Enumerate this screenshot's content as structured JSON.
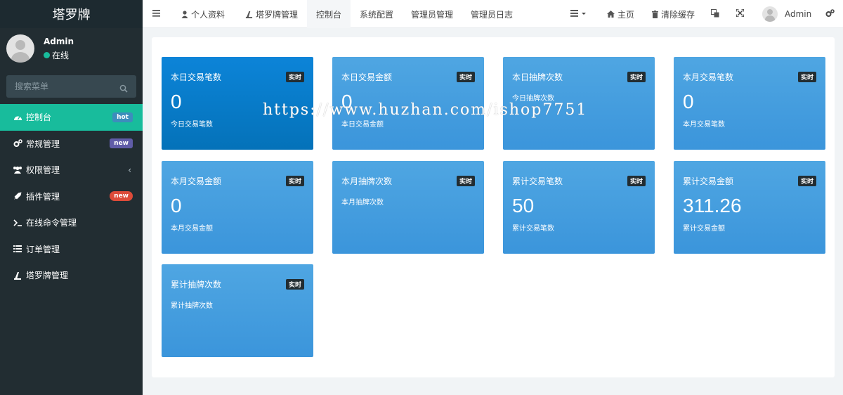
{
  "app": {
    "logo": "塔罗牌"
  },
  "user": {
    "name": "Admin",
    "status": "在线"
  },
  "search": {
    "placeholder": "搜索菜单"
  },
  "sidebar": {
    "items": [
      {
        "label": "控制台",
        "badge": "hot",
        "active": true
      },
      {
        "label": "常规管理",
        "badge": "new"
      },
      {
        "label": "权限管理"
      },
      {
        "label": "插件管理",
        "badge": "new"
      },
      {
        "label": "在线命令管理"
      },
      {
        "label": "订单管理"
      },
      {
        "label": "塔罗牌管理"
      }
    ]
  },
  "topbar": {
    "tabs": [
      {
        "label": "个人资料"
      },
      {
        "label": "塔罗牌管理"
      },
      {
        "label": "控制台",
        "active": true
      },
      {
        "label": "系统配置"
      },
      {
        "label": "管理员管理"
      },
      {
        "label": "管理员日志"
      }
    ],
    "home_label": "主页",
    "clear_cache_label": "清除缓存",
    "user_label": "Admin"
  },
  "cards": [
    {
      "title": "本日交易笔数",
      "badge": "实时",
      "value": "0",
      "sub": "今日交易笔数"
    },
    {
      "title": "本日交易金额",
      "badge": "实时",
      "value": "0",
      "sub": "本日交易金额"
    },
    {
      "title": "本日抽牌次数",
      "badge": "实时",
      "value": "",
      "sub": "今日抽牌次数"
    },
    {
      "title": "本月交易笔数",
      "badge": "实时",
      "value": "0",
      "sub": "本月交易笔数"
    },
    {
      "title": "本月交易金额",
      "badge": "实时",
      "value": "0",
      "sub": "本月交易金额"
    },
    {
      "title": "本月抽牌次数",
      "badge": "实时",
      "value": "",
      "sub": "本月抽牌次数"
    },
    {
      "title": "累计交易笔数",
      "badge": "实时",
      "value": "50",
      "sub": "累计交易笔数"
    },
    {
      "title": "累计交易金额",
      "badge": "实时",
      "value": "311.26",
      "sub": "累计交易金额"
    },
    {
      "title": "累计抽牌次数",
      "badge": "实时",
      "value": "",
      "sub": "累计抽牌次数"
    }
  ],
  "watermark": "https://www.huzhan.com/ishop7751",
  "colors": {
    "sidebar_bg": "#222d32",
    "accent": "#18bc9c",
    "card": "#3b95db",
    "card_dark": "#0472b9"
  }
}
